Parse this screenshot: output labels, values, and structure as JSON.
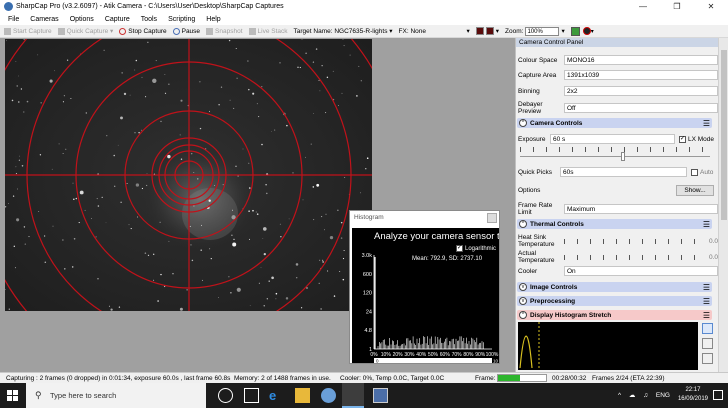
{
  "window": {
    "title": "SharpCap Pro (v3.2.6097) - Atik Camera - C:\\Users\\User\\Desktop\\SharpCap Captures"
  },
  "menu": [
    "File",
    "Cameras",
    "Options",
    "Capture",
    "Tools",
    "Scripting",
    "Help"
  ],
  "toolbar": {
    "start_capture": "Start Capture",
    "quick_capture": "Quick Capture",
    "stop_capture": "Stop Capture",
    "pause": "Pause",
    "snapshot": "Snapshot",
    "live_stack": "Live Stack",
    "target_name_label": "Target Name:",
    "target_name_value": "NGC7635-R-lights",
    "fx_label": "FX:",
    "fx_value": "None",
    "zoom_label": "Zoom:",
    "zoom_value": "100%"
  },
  "panel": {
    "title": "Camera Control Panel",
    "rows": [
      {
        "label": "Colour Space",
        "value": "MONO16"
      },
      {
        "label": "Capture Area",
        "value": "1391x1039"
      },
      {
        "label": "Binning",
        "value": "2x2"
      },
      {
        "label": "Debayer Preview",
        "value": "Off"
      }
    ],
    "camera_controls": {
      "header": "Camera Controls",
      "exposure_label": "Exposure",
      "exposure_value": "60 s",
      "lx_mode_label": "LX Mode",
      "quick_picks_label": "Quick Picks",
      "quick_picks_value": "60s",
      "auto_label": "Auto",
      "options_label": "Options",
      "show_button": "Show...",
      "frame_rate_label": "Frame Rate Limit",
      "frame_rate_value": "Maximum"
    },
    "thermal_controls": {
      "header": "Thermal Controls",
      "heat_sink_label": "Heat Sink Temperature",
      "heat_sink_value": "0.0",
      "actual_temp_label": "Actual Temperature",
      "actual_temp_value": "0.0",
      "cooler_label": "Cooler",
      "cooler_value": "On"
    },
    "image_controls_header": "Image Controls",
    "preprocessing_header": "Preprocessing",
    "display_stretch_header": "Display Histogram Stretch"
  },
  "histogram": {
    "title": "Histogram",
    "banner": "Analyze your camera sensor t",
    "logarithmic_label": "Logarithmic",
    "stats": "Mean: 792.9, SD: 2737.10",
    "y_ticks": [
      "3.0k",
      "600",
      "120",
      "24",
      "4.8",
      "1"
    ],
    "x_ticks": [
      "0%",
      "10%",
      "20%",
      "30%",
      "40%",
      "50%",
      "60%",
      "70%",
      "80%",
      "90%",
      "100%"
    ],
    "scale_start": "0",
    "scale_end": "10"
  },
  "statusbar": {
    "capturing": "Capturing : 2 frames (0 dropped) in 0:01:34, exposure 60.0s , last frame 60.8s",
    "memory": "Memory: 2 of 1488 frames in use.",
    "cooler": "Cooler: 0%, Temp 0.0C, Target 0.0C",
    "frame_label": "Frame:",
    "frame_progress": 0.45,
    "elapsed": "00:28/00:32",
    "frames_count": "Frames 2/24 (ETA 22:39)"
  },
  "taskbar": {
    "search_placeholder": "Type here to search",
    "time": "22:17",
    "date": "16/09/2019",
    "language": "ENG"
  },
  "colors": {
    "crosshair": "#c0121a",
    "panel_header_blue": "#c9d3f0",
    "panel_header_red": "#f6c9c9",
    "progress_green": "#2db52d"
  }
}
